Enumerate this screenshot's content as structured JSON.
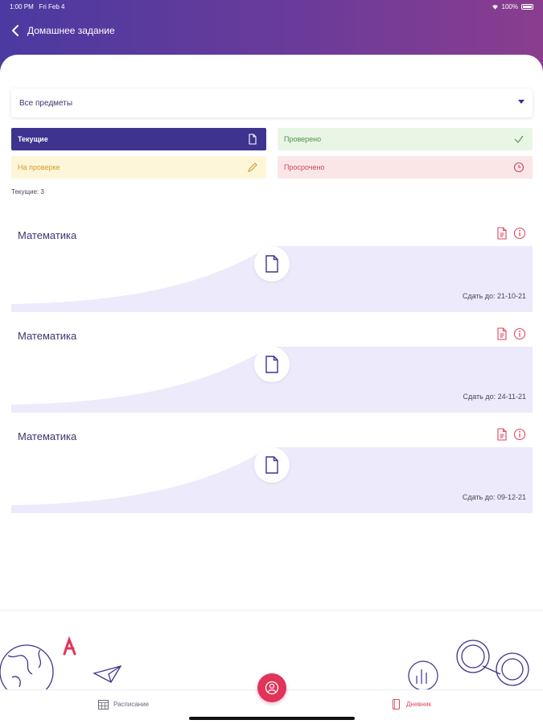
{
  "status_bar": {
    "time": "1:00 PM",
    "date": "Fri Feb 4",
    "battery": "100%"
  },
  "nav": {
    "title": "Домашнее задание",
    "back_icon": "chevron-left-icon"
  },
  "subject_select": {
    "value": "Все предметы"
  },
  "filters": {
    "current": "Текущие",
    "checked": "Проверено",
    "on_review": "На проверке",
    "overdue": "Просрочено"
  },
  "count_label": "Текущие: 3",
  "homework": [
    {
      "subject": "Математика",
      "due": "Сдать до: 21-10-21"
    },
    {
      "subject": "Математика",
      "due": "Сдать до: 24-11-21"
    },
    {
      "subject": "Математика",
      "due": "Сдать до: 09-12-21"
    }
  ],
  "tabbar": {
    "schedule": "Расписание",
    "diary": "Дневник"
  },
  "colors": {
    "primary": "#3e338f",
    "accent": "#e0345a",
    "card_bg": "#edeafb",
    "checked_bg": "#e9f6e6",
    "review_bg": "#fdf6d9",
    "overdue_bg": "#fbe6e7"
  }
}
